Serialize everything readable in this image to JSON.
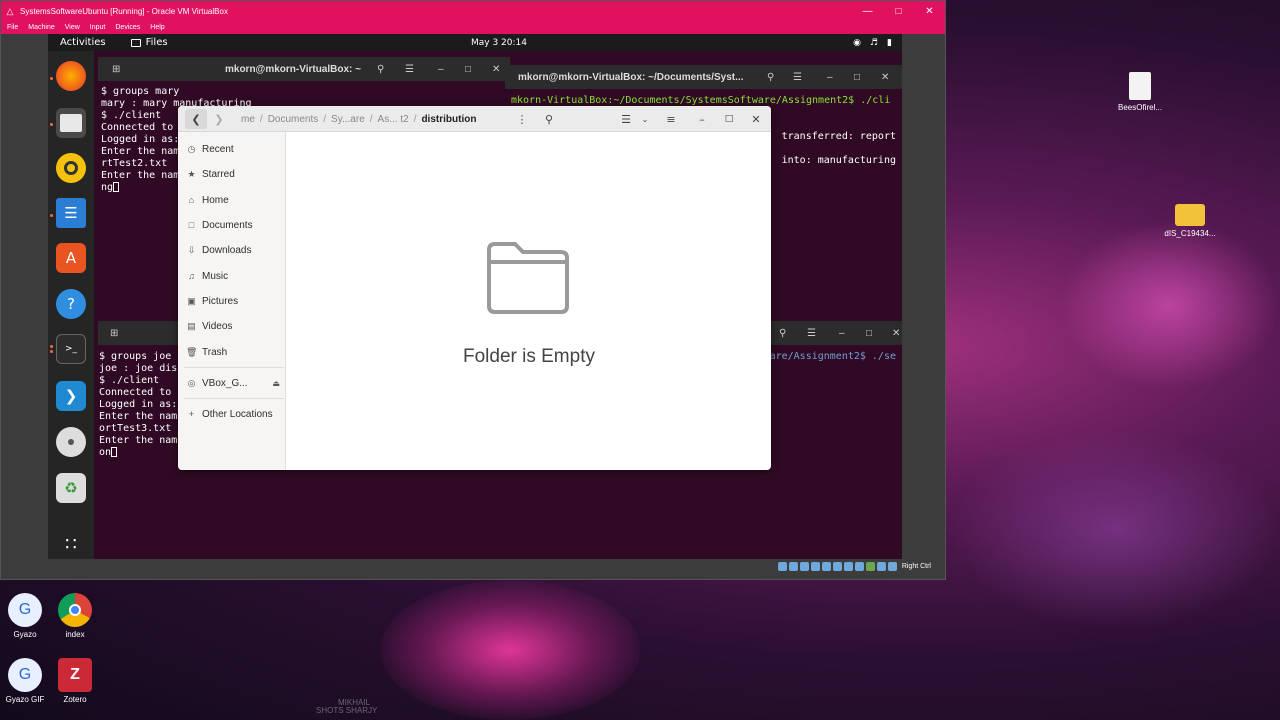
{
  "host": {
    "window_title": "SystemsSoftwareUbuntu [Running] - Oracle VM VirtualBox",
    "menu": [
      "File",
      "Machine",
      "View",
      "Input",
      "Devices",
      "Help"
    ],
    "status_right": "Right Ctrl"
  },
  "topbar": {
    "activities": "Activities",
    "app_name": "Files",
    "clock": "May 3  20:14"
  },
  "dock": {
    "items": [
      "firefox-icon",
      "files-icon",
      "rhythmbox-icon",
      "writer-icon",
      "software-icon",
      "help-icon",
      "terminal-icon",
      "vscode-icon",
      "disc-icon",
      "trash-icon",
      "apps-grid-icon"
    ]
  },
  "term1": {
    "title": "mkorn@mkorn-VirtualBox: ~",
    "lines": [
      "$ groups mary",
      "mary : mary manufacturing",
      "$ ./client",
      "Connected to",
      "Logged in as:",
      "Enter the nam",
      "rtTest2.txt",
      "Enter the nam",
      "ng"
    ]
  },
  "term2": {
    "title": "mkorn@mkorn-VirtualBox: ~/Documents/Syst...",
    "lines": [
      "mkorn-VirtualBox:~/Documents/SystemsSoftware/Assignment2$ ./cli",
      "",
      "",
      "   transferred: report",
      "",
      "   into: manufacturing"
    ]
  },
  "term3": {
    "lines": [
      "$ groups joe",
      "joe : joe dis",
      "$ ./client",
      "Connected to",
      "Logged in as:",
      "Enter the nam",
      "ortTest3.txt",
      "Enter the nam",
      "on"
    ]
  },
  "term4": {
    "lines": [
      "ware/Assignment2$ ./se"
    ]
  },
  "files": {
    "breadcrumbs": [
      "me",
      "Documents",
      "Sy...are",
      "As... t2"
    ],
    "current_folder": "distribution",
    "sidebar": [
      {
        "label": "Recent",
        "icon": "clock-icon"
      },
      {
        "label": "Starred",
        "icon": "star-icon"
      },
      {
        "label": "Home",
        "icon": "home-icon"
      },
      {
        "label": "Documents",
        "icon": "document-icon"
      },
      {
        "label": "Downloads",
        "icon": "download-icon"
      },
      {
        "label": "Music",
        "icon": "music-icon"
      },
      {
        "label": "Pictures",
        "icon": "picture-icon"
      },
      {
        "label": "Videos",
        "icon": "video-icon"
      },
      {
        "label": "Trash",
        "icon": "trash-icon"
      },
      {
        "label": "VBox_G...",
        "icon": "disc-icon"
      },
      {
        "label": "Other Locations",
        "icon": "plus-icon"
      }
    ],
    "empty_message": "Folder is Empty"
  },
  "desktop": {
    "icons": [
      {
        "label": "BeesOfirel...",
        "icon": "file-icon"
      },
      {
        "label": "dIS_C19434...",
        "icon": "folder-icon"
      },
      {
        "label": "Gyazo",
        "icon": "gyazo-icon"
      },
      {
        "label": "index",
        "icon": "chrome-icon"
      },
      {
        "label": "Gyazo GIF",
        "icon": "gyazo-gif-icon"
      },
      {
        "label": "Zotero",
        "icon": "zotero-icon"
      }
    ],
    "watermark_line1": "MIKHAIL",
    "watermark_line2": "SHOTS  SHARJY"
  }
}
